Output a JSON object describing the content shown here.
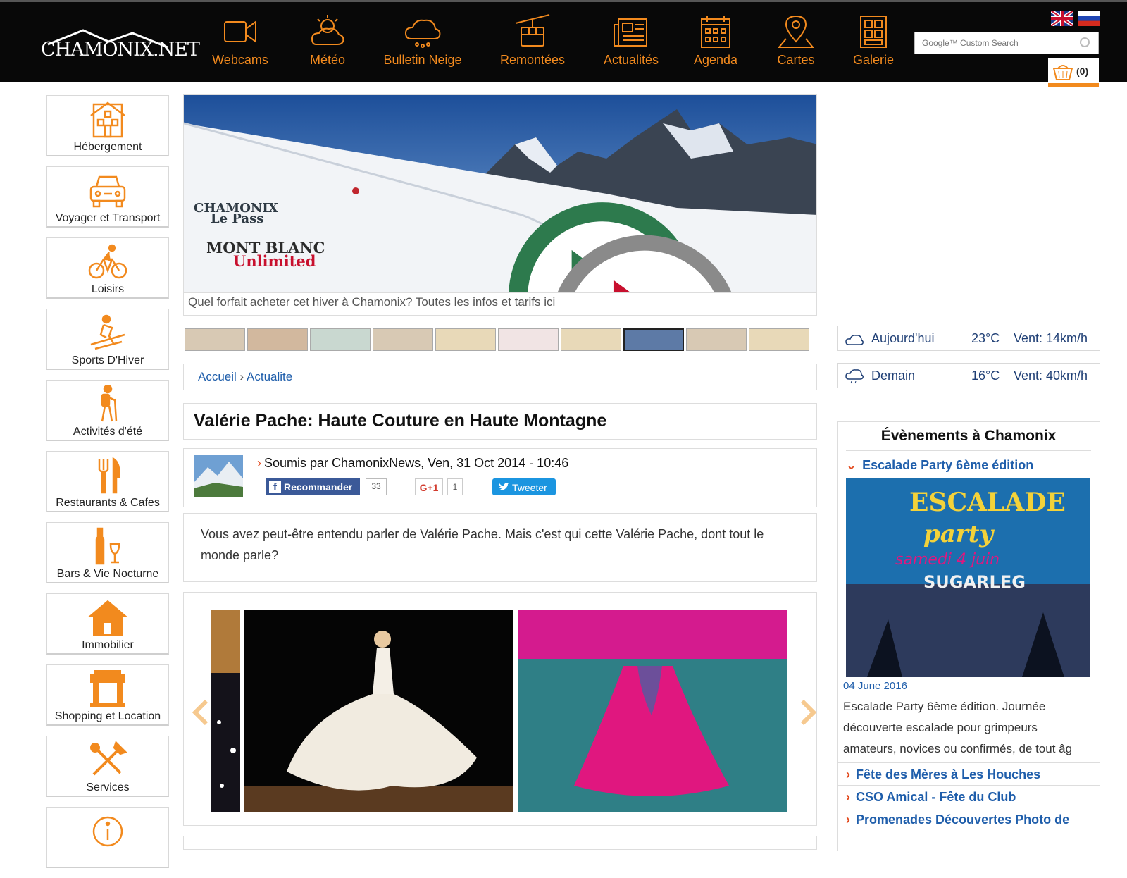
{
  "header": {
    "logo_text": "CHAMONIX.NET",
    "nav": [
      {
        "label": "Webcams",
        "icon": "webcam-icon"
      },
      {
        "label": "Météo",
        "icon": "weather-icon"
      },
      {
        "label": "Bulletin Neige",
        "icon": "snow-cloud-icon"
      },
      {
        "label": "Remontées",
        "icon": "cable-car-icon"
      },
      {
        "label": "Actualités",
        "icon": "newspaper-icon"
      },
      {
        "label": "Agenda",
        "icon": "calendar-icon"
      },
      {
        "label": "Cartes",
        "icon": "map-pin-icon"
      },
      {
        "label": "Galerie",
        "icon": "gallery-icon"
      }
    ],
    "search_placeholder": "Google™ Custom Search",
    "cart_count": "(0)",
    "accent_color": "#f28a1e"
  },
  "sidebar": {
    "items": [
      {
        "label": "Hébergement",
        "icon": "house-icon"
      },
      {
        "label": "Voyager et Transport",
        "icon": "car-icon"
      },
      {
        "label": "Loisirs",
        "icon": "cyclist-icon"
      },
      {
        "label": "Sports D'Hiver",
        "icon": "skier-icon"
      },
      {
        "label": "Activités d'été",
        "icon": "hiker-icon"
      },
      {
        "label": "Restaurants & Cafes",
        "icon": "cutlery-icon"
      },
      {
        "label": "Bars & Vie Nocturne",
        "icon": "wine-icon"
      },
      {
        "label": "Immobilier",
        "icon": "home-icon"
      },
      {
        "label": "Shopping et Location",
        "icon": "shop-icon"
      },
      {
        "label": "Services",
        "icon": "tools-icon"
      },
      {
        "label": "",
        "icon": "info-icon"
      }
    ]
  },
  "banner": {
    "brand1_line1": "CHAMONIX",
    "brand1_line2": "Le Pass",
    "brand2_line1": "MONT BLANC",
    "brand2_line2": "Unlimited",
    "caption": "Quel forfait acheter cet hiver à Chamonix? Toutes les infos et tarifs ici"
  },
  "breadcrumb": {
    "home": "Accueil",
    "separator": "›",
    "current": "Actualite"
  },
  "article": {
    "title": "Valérie Pache: Haute Couture en Haute Montagne",
    "byline": "Soumis par ChamonixNews, Ven, 31 Oct 2014 - 10:46",
    "fb_label": "Recommander",
    "fb_count": "33",
    "gplus_label": "G+1",
    "gplus_count": "1",
    "tweet_label": "Tweeter",
    "lead": "Vous avez peut-être entendu parler de Valérie Pache. Mais c'est qui cette Valérie Pache, dont tout le monde parle?"
  },
  "weather": [
    {
      "day": "Aujourd'hui",
      "temp": "23°C",
      "wind": "Vent: 14km/h"
    },
    {
      "day": "Demain",
      "temp": "16°C",
      "wind": "Vent: 40km/h"
    }
  ],
  "events": {
    "title": "Évènements à Chamonix",
    "featured_title": "Escalade Party 6ème édition",
    "poster_line1": "ESCALADE",
    "poster_line2": "party",
    "poster_line3": "samedi 4 juin",
    "poster_line4": "SUGARLEG",
    "date": "04 June 2016",
    "excerpt_line1": "Escalade Party 6ème édition. Journée",
    "excerpt_line2": "découverte escalade pour grimpeurs",
    "excerpt_line3": "amateurs, novices ou confirmés, de tout âg",
    "links": [
      "Fête des Mères à Les Houches",
      "CSO Amical - Fête du Club",
      "Promenades Découvertes Photo de"
    ]
  }
}
